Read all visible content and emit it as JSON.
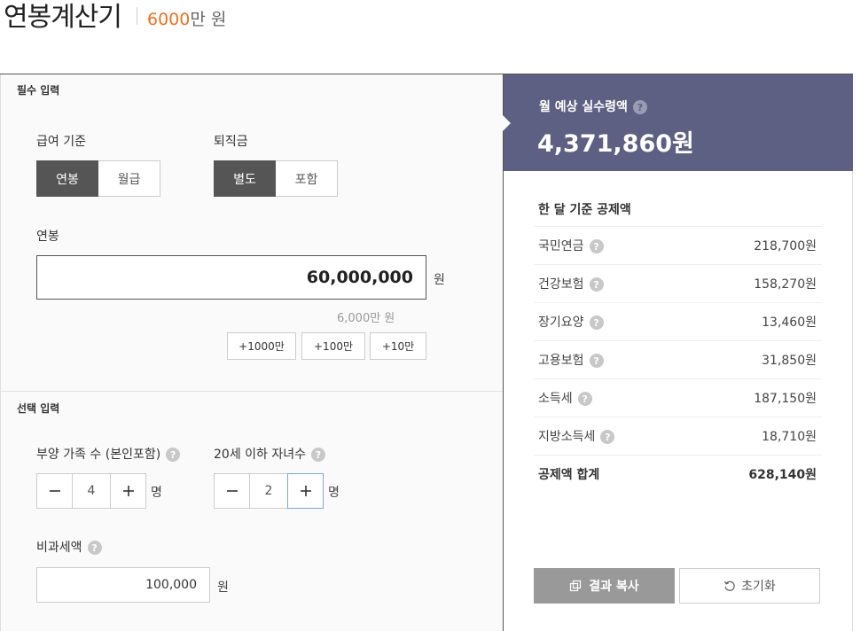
{
  "header": {
    "title": "연봉계산기",
    "amount": "6000",
    "amount_unit": "만 원"
  },
  "required": {
    "section_label": "필수 입력",
    "pay_basis": {
      "label": "급여 기준",
      "options": [
        "연봉",
        "월급"
      ],
      "selected": "연봉"
    },
    "severance": {
      "label": "퇴직금",
      "options": [
        "별도",
        "포함"
      ],
      "selected": "별도"
    },
    "salary": {
      "label": "연봉",
      "value": "60,000,000",
      "unit": "원",
      "sub_text": "6,000만 원",
      "quick_buttons": [
        "+1000만",
        "+100만",
        "+10만"
      ]
    }
  },
  "optional": {
    "section_label": "선택 입력",
    "dependents": {
      "label": "부양 가족 수 (본인포함)",
      "value": "4",
      "unit": "명"
    },
    "children": {
      "label": "20세 이하 자녀수",
      "value": "2",
      "unit": "명"
    },
    "nontax": {
      "label": "비과세액",
      "value": "100,000",
      "unit": "원"
    }
  },
  "help_glyph": "?",
  "result": {
    "label": "월 예상 실수령액",
    "value": "4,371,860원",
    "deductions_title": "한 달 기준 공제액",
    "deductions": [
      {
        "name": "국민연금",
        "amount": "218,700원"
      },
      {
        "name": "건강보험",
        "amount": "158,270원"
      },
      {
        "name": "장기요양",
        "amount": "13,460원"
      },
      {
        "name": "고용보험",
        "amount": "31,850원"
      },
      {
        "name": "소득세",
        "amount": "187,150원"
      },
      {
        "name": "지방소득세",
        "amount": "18,710원"
      }
    ],
    "total": {
      "name": "공제액 합계",
      "amount": "628,140원"
    },
    "copy_label": "결과 복사",
    "reset_label": "초기화"
  },
  "colors": {
    "accent": "#f26f21",
    "result_bg": "#5d6082",
    "active_segment": "#555555",
    "copy_button": "#999999"
  },
  "icons": {
    "minus": "minus-icon",
    "plus": "plus-icon",
    "help": "help-circle-icon",
    "copy": "copy-icon",
    "reset": "reset-icon"
  }
}
